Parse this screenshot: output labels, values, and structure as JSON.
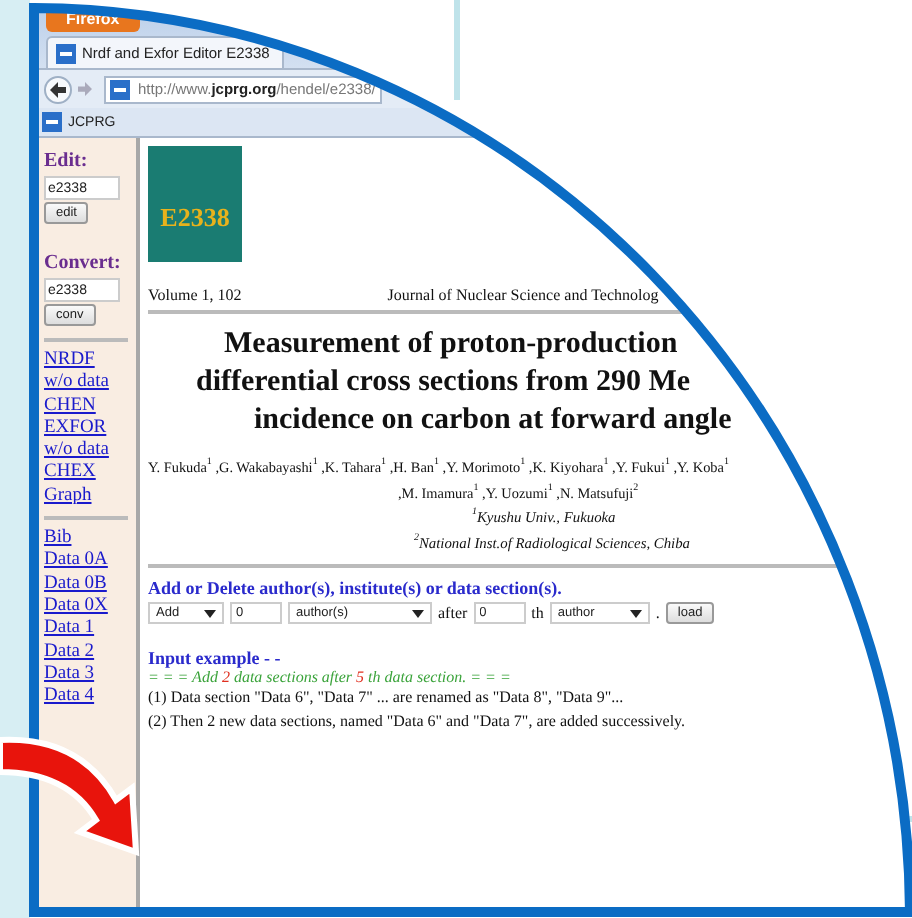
{
  "browser": {
    "menu_button": "Firefox",
    "tab_title": "Nrdf and Exfor Editor E2338",
    "address_parts": [
      {
        "text": "http://www.",
        "bold": false
      },
      {
        "text": "jcprg.org",
        "bold": true
      },
      {
        "text": "/hendel/e2338/",
        "bold": false
      }
    ],
    "bookmark": "JCPRG"
  },
  "sidebar": {
    "sections": [
      {
        "label": "Edit:",
        "value": "e2338",
        "button": "edit"
      },
      {
        "label": "Convert:",
        "value": "e2338",
        "button": "conv"
      }
    ],
    "link_groups": [
      [
        "NRDF",
        "w/o data",
        "CHEN",
        "EXFOR",
        "w/o data",
        "CHEX",
        "Graph"
      ],
      [
        "Bib",
        "Data 0A",
        "Data 0B",
        "Data 0X",
        "Data 1",
        "Data 2",
        "Data 3",
        "Data 4"
      ]
    ]
  },
  "article": {
    "logo": "E2338",
    "volume": "Volume 1, 102",
    "journal": "Journal of Nuclear Science and Technolog",
    "title_lines": [
      "Measurement of proton-production",
      "differential cross sections from 290 Me",
      "incidence on carbon at forward angle"
    ],
    "author_lines": [
      "Y. Fukuda$^{1}$ ,G. Wakabayashi$^{1}$ ,K. Tahara$^{1}$ ,H. Ban$^{1}$ ,Y. Morimoto$^{1}$ ,K. Kiyohara$^{1}$ ,Y. Fukui$^{1}$ ,Y. Koba$^{1}$",
      ",M. Imamura$^{1}$ ,Y. Uozumi$^{1}$ ,N. Matsufuji$^{2}$"
    ],
    "affiliations": [
      "$^{1}$Kyushu Univ., Fukuoka",
      "$^{2}$National Inst.of Radiological Sciences, Chiba"
    ]
  },
  "form": {
    "heading": "Add or Delete author(s), institute(s) or data section(s).",
    "controls": [
      {
        "kind": "select",
        "value": "Add"
      },
      {
        "kind": "input",
        "value": "0"
      },
      {
        "kind": "select",
        "value": "author(s)"
      },
      {
        "kind": "text",
        "text": "after"
      },
      {
        "kind": "input",
        "value": "0"
      },
      {
        "kind": "text",
        "text": "th"
      },
      {
        "kind": "select",
        "value": "author"
      },
      {
        "kind": "text",
        "text": "."
      },
      {
        "kind": "button",
        "label": "load"
      }
    ]
  },
  "example": {
    "heading": "Input example - -",
    "rule_parts": [
      {
        "text": "= = = Add ",
        "highlight": false
      },
      {
        "text": "2",
        "highlight": true
      },
      {
        "text": " data sections after ",
        "highlight": false
      },
      {
        "text": "5",
        "highlight": true
      },
      {
        "text": " th data section. = = =",
        "highlight": false
      }
    ],
    "lines": [
      "(1) Data section \"Data 6\", \"Data 7\" ... are renamed as \"Data 8\", \"Data 9\"...",
      "(2) Then 2 new data sections, named \"Data 6\" and \"Data 7\", are added successively."
    ]
  }
}
